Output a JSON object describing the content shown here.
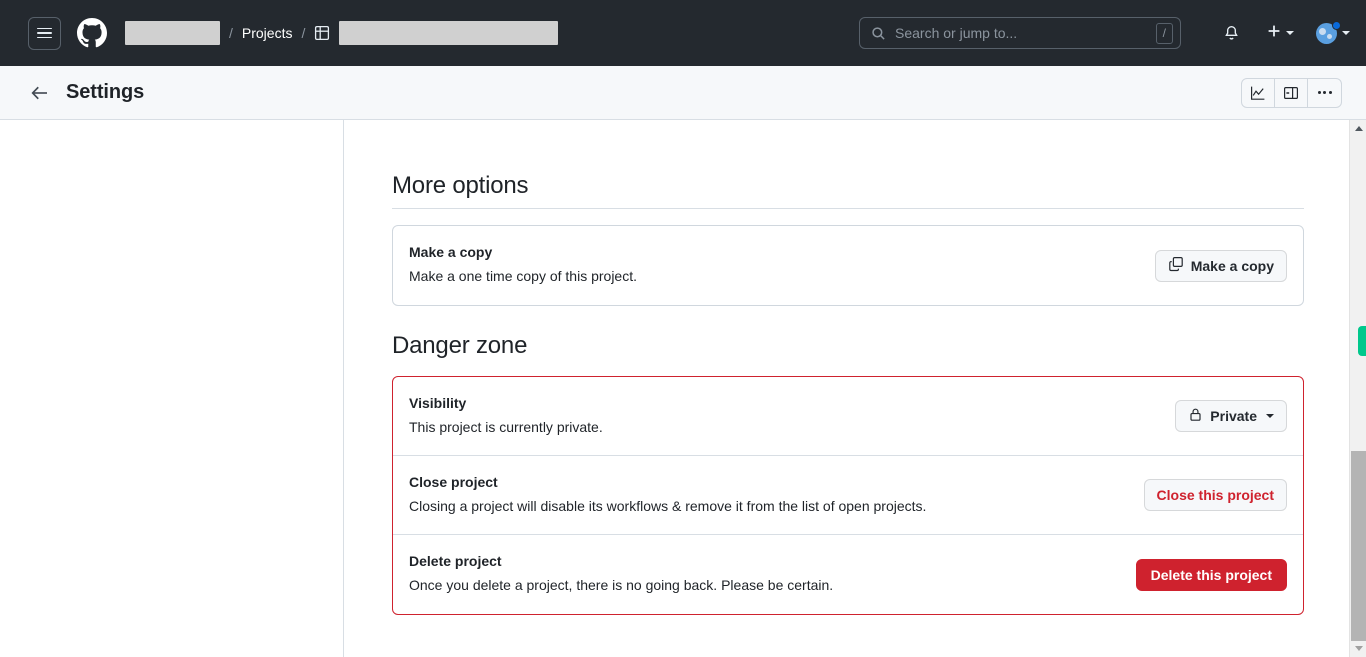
{
  "header": {
    "menu_icon": "hamburger-menu-icon",
    "logo_icon": "github-logo-icon",
    "breadcrumb": {
      "owner_redacted": "",
      "separator": "/",
      "projects_label": "Projects",
      "project_icon": "project-table-icon",
      "project_name_redacted": ""
    },
    "search": {
      "placeholder": "Search or jump to...",
      "shortcut": "/",
      "icon": "search-icon"
    },
    "notifications_icon": "bell-icon",
    "create_new": {
      "label": "+",
      "icon": "plus-icon",
      "caret": "chevron-down-icon"
    },
    "account": {
      "avatar_icon": "avatar",
      "has_notification_dot": true,
      "caret": "chevron-down-icon"
    }
  },
  "subheader": {
    "back_icon": "arrow-left-icon",
    "title": "Settings",
    "actions": [
      {
        "name": "insights-button",
        "icon": "line-chart-icon"
      },
      {
        "name": "toggle-sidebar-button",
        "icon": "sidebar-panel-icon"
      },
      {
        "name": "more-options-button",
        "icon": "kebab-horizontal-icon"
      }
    ]
  },
  "main": {
    "more_options": {
      "heading": "More options",
      "rows": [
        {
          "title": "Make a copy",
          "description": "Make a one time copy of this project.",
          "button_label": "Make a copy",
          "button_icon": "copy-icon"
        }
      ]
    },
    "danger_zone": {
      "heading": "Danger zone",
      "border_color": "#cf222e",
      "rows": [
        {
          "title": "Visibility",
          "description": "This project is currently private.",
          "button_label": "Private",
          "button_icon": "lock-icon",
          "has_caret": true
        },
        {
          "title": "Close project",
          "description": "Closing a project will disable its workflows & remove it from the list of open projects.",
          "button_label": "Close this project",
          "button_style": "danger-outline"
        },
        {
          "title": "Delete project",
          "description": "Once you delete a project, there is no going back. Please be certain.",
          "button_label": "Delete this project",
          "button_style": "danger-solid"
        }
      ]
    }
  },
  "scrollbar": {
    "up_arrow": "scroll-up-arrow",
    "down_arrow": "scroll-down-arrow",
    "marker_color": "#00c88c"
  }
}
